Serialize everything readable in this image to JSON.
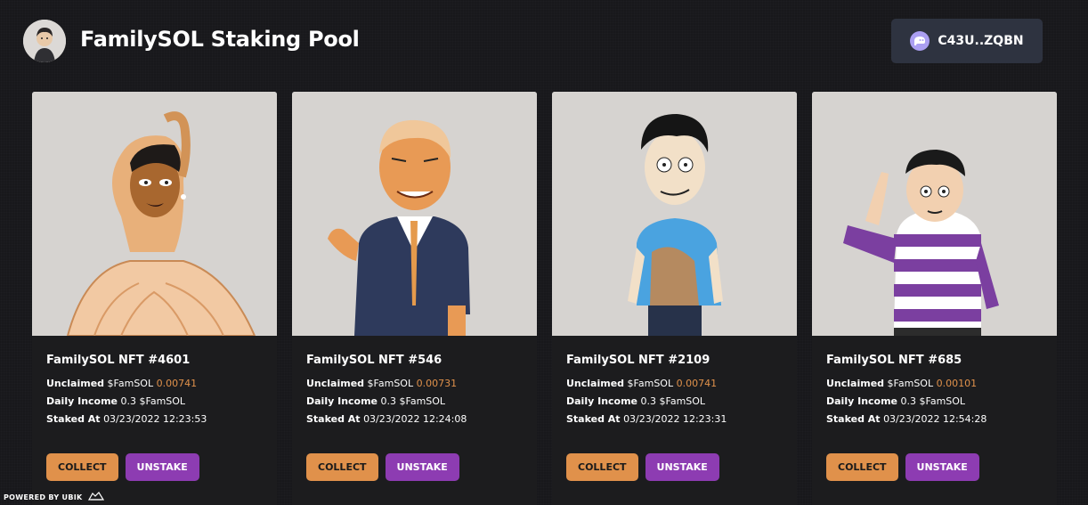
{
  "header": {
    "title": "FamilySOL Staking Pool",
    "logo_icon": "avatar-logo",
    "wallet_label": "C43U..ZQBN",
    "wallet_icon": "phantom-ghost-icon"
  },
  "colors": {
    "accent_orange": "#e0914b",
    "accent_purple": "#8d3cb2",
    "background": "#18181b",
    "card": "#1c1c1e"
  },
  "labels": {
    "unclaimed": "Unclaimed",
    "daily_income": "Daily Income",
    "staked_at": "Staked At",
    "collect": "COLLECT",
    "unstake": "UNSTAKE"
  },
  "cards": [
    {
      "name": "FamilySOL NFT #4601",
      "currency": "$FamSOL",
      "unclaimed": "0.00741",
      "daily_income": "0.3 $FamSOL",
      "staked_at": "03/23/2022 12:23:53"
    },
    {
      "name": "FamilySOL NFT #546",
      "currency": "$FamSOL",
      "unclaimed": "0.00731",
      "daily_income": "0.3 $FamSOL",
      "staked_at": "03/23/2022 12:24:08"
    },
    {
      "name": "FamilySOL NFT #2109",
      "currency": "$FamSOL",
      "unclaimed": "0.00741",
      "daily_income": "0.3 $FamSOL",
      "staked_at": "03/23/2022 12:23:31"
    },
    {
      "name": "FamilySOL NFT #685",
      "currency": "$FamSOL",
      "unclaimed": "0.00101",
      "daily_income": "0.3 $FamSOL",
      "staked_at": "03/23/2022 12:54:28"
    }
  ],
  "footer": {
    "powered_by": "POWERED BY UBIK",
    "powered_icon": "ubik-logo-icon"
  }
}
